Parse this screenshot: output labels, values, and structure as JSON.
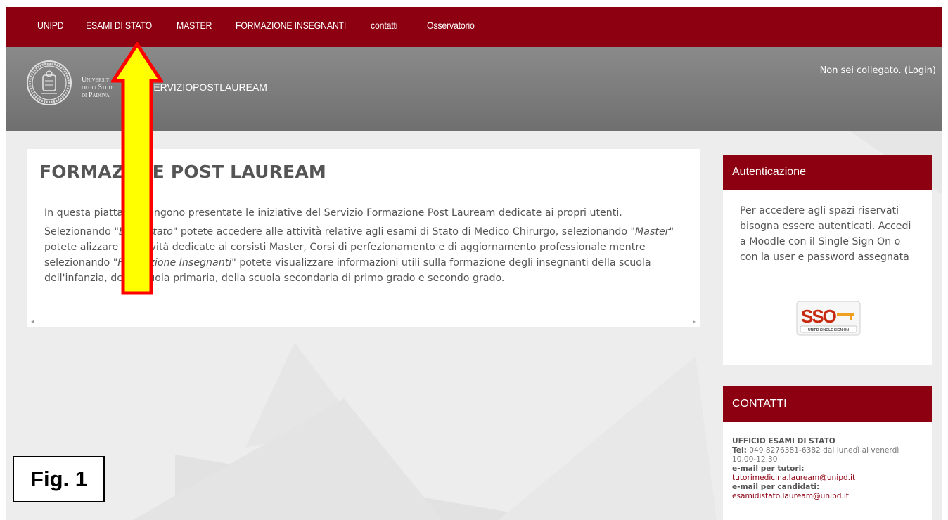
{
  "nav": {
    "items": [
      "UNIPD",
      "ESAMI DI STATO",
      "MASTER",
      "FORMAZIONE INSEGNANTI",
      "contatti",
      "Osservatorio"
    ]
  },
  "banner": {
    "university_line1": "Universit",
    "university_line2": "degli Studi",
    "university_line3": "di Padova",
    "site_name": "SERVIZIOPOSTLAUREAM",
    "login_status": "Non sei collegato. (",
    "login_link": "Login",
    "login_close": ")"
  },
  "main": {
    "title": "FORMAZI   NE POST LAUREAM",
    "p1": "In questa piatta      na vengono presentate le iniziative del Servizio Formazione Post Lauream dedicate ai propri utenti.",
    "p2_a": "Selezionando ",
    "p2_em1": "\"E     i di Stato\"",
    "p2_b": " potete accedere alle attività relative agli esami di Stato di Medico Chirurgo, selezionando ",
    "p2_em2": "\"Master\"",
    "p2_c": " potete      alizzare le attività dedicate ai corsisti Master, Corsi di perfezionamento e di aggiornamento professionale mentre selezionando ",
    "p2_em3": "\"Formazione Insegnanti\"",
    "p2_d": " potete visualizzare informazioni utili sulla formazione degli insegnanti della scuola dell'infanzia, della scuola primaria, della scuola secondaria di primo grado e secondo grado."
  },
  "auth": {
    "header": "Autenticazione",
    "text": "Per accedere agli spazi riservati bisogna essere autenticati. Accedi a Moodle con il Single Sign On o con la user e password assegnata",
    "sso_letters": "SSO",
    "sso_caption": "UNIPD SINGLE SIGN ON"
  },
  "contacts": {
    "header": "CONTATTI",
    "office": "UFFICIO ESAMI DI STATO",
    "tel_label": "Tel:",
    "tel_value": " 049 8276381-6382 dal lunedì al venerdì 10.00-12.30",
    "tutor_label": "e-mail per tutori:",
    "tutor_email": "tutorimedicina.lauream@unipd.it",
    "cand_label": "e-mail per candidati:",
    "cand_email": "esamidistato.lauream@unipd.it"
  },
  "annotation": {
    "fig_label": "Fig. 1",
    "arrow_color": "#ffff00",
    "arrow_border": "#ff0000"
  },
  "colors": {
    "brand": "#8d0011",
    "banner": "#7d7d7d",
    "background": "#ededed"
  }
}
